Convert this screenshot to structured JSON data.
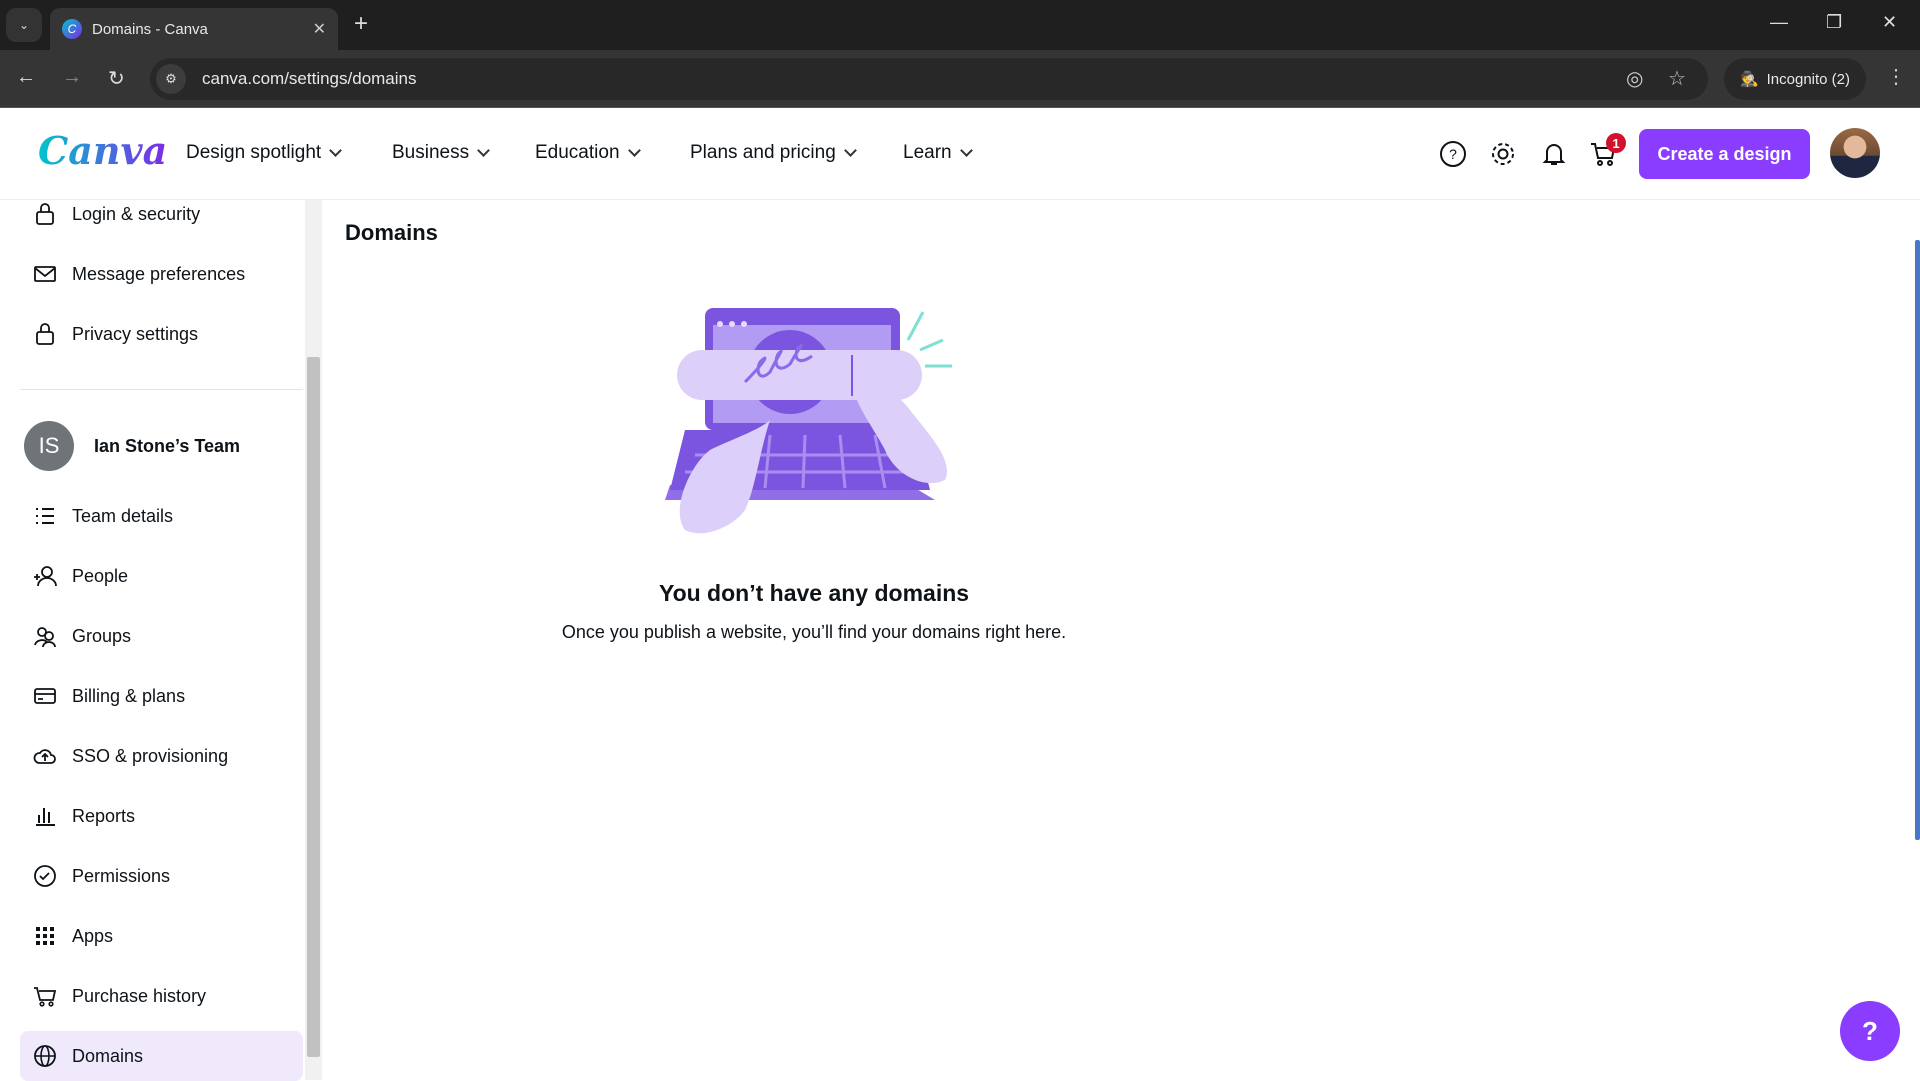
{
  "browser": {
    "tab_title": "Domains - Canva",
    "url": "canva.com/settings/domains",
    "incognito_label": "Incognito (2)"
  },
  "header": {
    "logo": "Canva",
    "menu": [
      {
        "label": "Design spotlight"
      },
      {
        "label": "Business"
      },
      {
        "label": "Education"
      },
      {
        "label": "Plans and pricing"
      },
      {
        "label": "Learn"
      }
    ],
    "cart_count": "1",
    "create_label": "Create a design",
    "accent_color": "#8b3dff"
  },
  "sidebar": {
    "account_items": [
      {
        "label": "Login & security",
        "icon": "lock-icon"
      },
      {
        "label": "Message preferences",
        "icon": "envelope-icon"
      },
      {
        "label": "Privacy settings",
        "icon": "lock-icon"
      }
    ],
    "team": {
      "initials": "IS",
      "name": "Ian Stone’s Team"
    },
    "team_items": [
      {
        "label": "Team details",
        "icon": "list-icon"
      },
      {
        "label": "People",
        "icon": "add-person-icon"
      },
      {
        "label": "Groups",
        "icon": "group-icon"
      },
      {
        "label": "Billing & plans",
        "icon": "credit-card-icon"
      },
      {
        "label": "SSO & provisioning",
        "icon": "cloud-upload-icon"
      },
      {
        "label": "Reports",
        "icon": "bar-chart-icon"
      },
      {
        "label": "Permissions",
        "icon": "check-circle-icon"
      },
      {
        "label": "Apps",
        "icon": "grid-icon"
      },
      {
        "label": "Purchase history",
        "icon": "cart-icon"
      },
      {
        "label": "Domains",
        "icon": "globe-icon",
        "active": true
      }
    ]
  },
  "main": {
    "title": "Domains",
    "empty_title": "You don’t have any domains",
    "empty_subtitle": "Once you publish a website, you’ll find your domains right here."
  },
  "help_fab": "?"
}
